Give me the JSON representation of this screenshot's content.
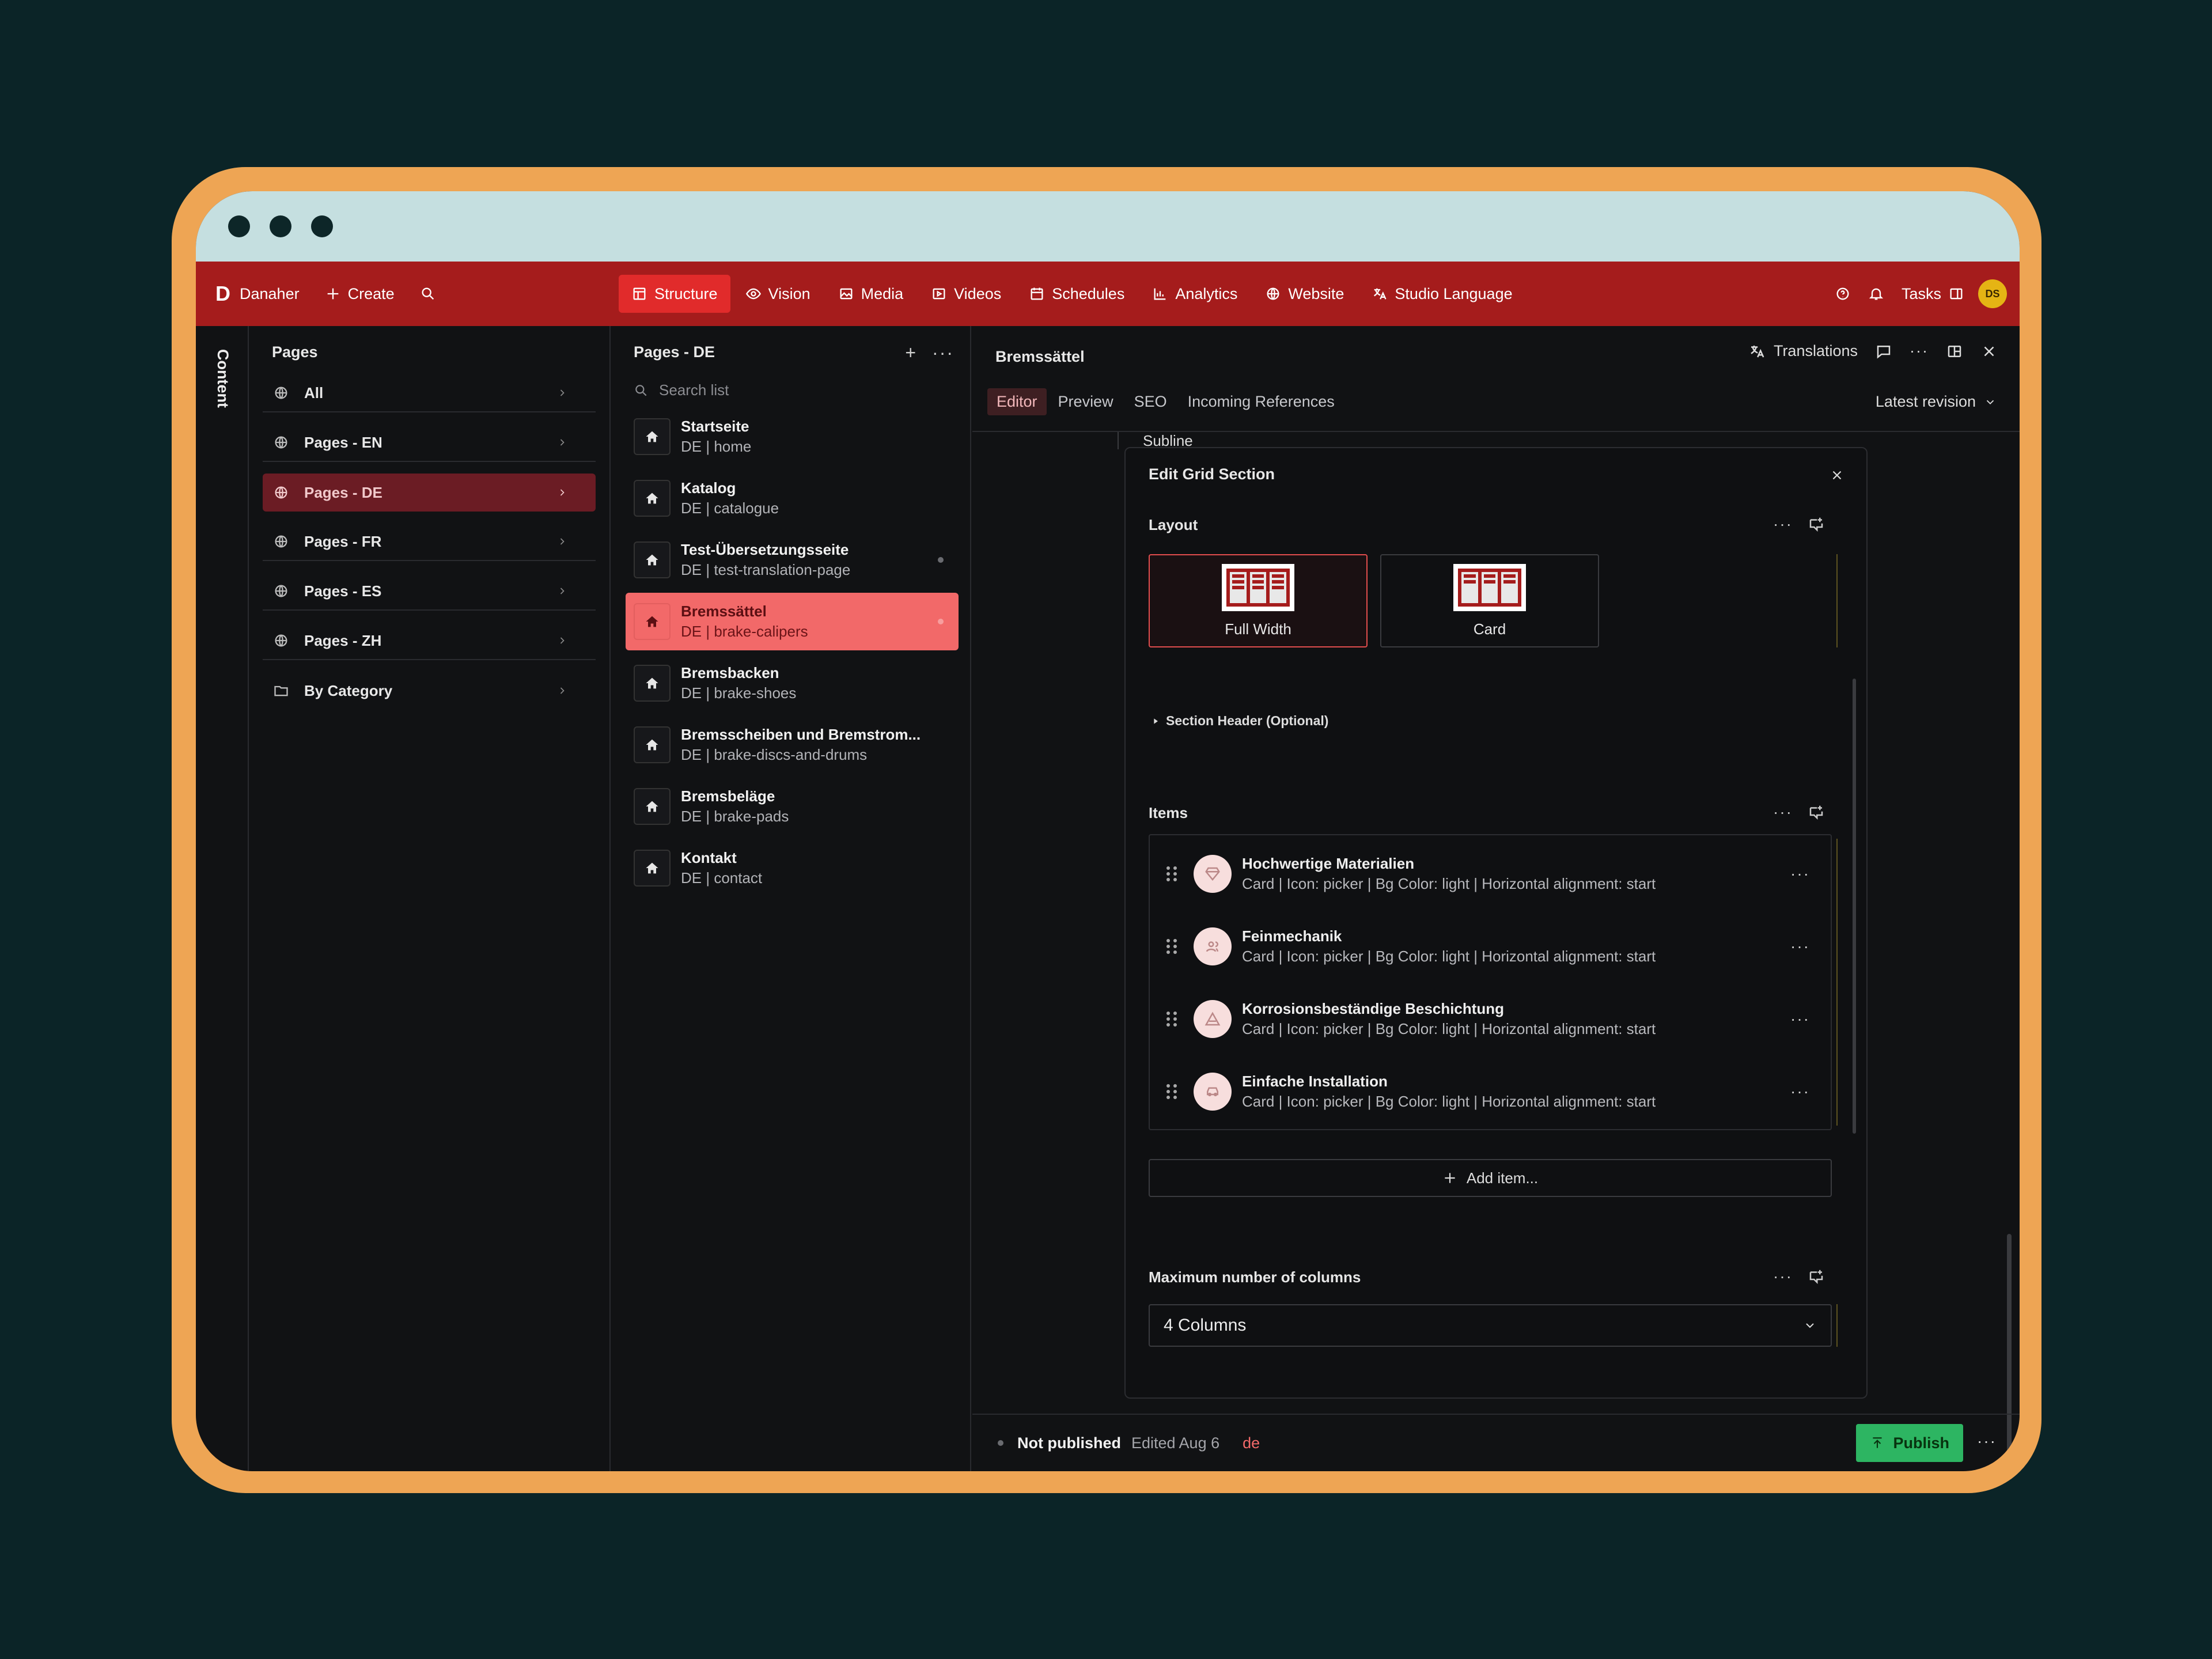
{
  "app": {
    "logo": "D",
    "workspace": "Danaher",
    "create_label": "Create",
    "tasks_label": "Tasks",
    "avatar_initials": "DS"
  },
  "nav": {
    "tools": [
      {
        "label": "Structure",
        "icon": "structure-icon",
        "active": true
      },
      {
        "label": "Vision",
        "icon": "eye-icon"
      },
      {
        "label": "Media",
        "icon": "image-icon"
      },
      {
        "label": "Videos",
        "icon": "video-icon"
      },
      {
        "label": "Schedules",
        "icon": "calendar-icon"
      },
      {
        "label": "Analytics",
        "icon": "chart-icon"
      },
      {
        "label": "Website",
        "icon": "globe-icon"
      },
      {
        "label": "Studio Language",
        "icon": "translate-icon"
      }
    ]
  },
  "rail": {
    "label": "Content"
  },
  "pages_panel": {
    "title": "Pages",
    "items": [
      {
        "label": "All",
        "icon": "globe-icon"
      },
      {
        "label": "Pages - EN",
        "icon": "globe-icon"
      },
      {
        "label": "Pages - DE",
        "icon": "globe-icon",
        "active": true
      },
      {
        "label": "Pages - FR",
        "icon": "globe-icon"
      },
      {
        "label": "Pages - ES",
        "icon": "globe-icon"
      },
      {
        "label": "Pages - ZH",
        "icon": "globe-icon"
      },
      {
        "label": "By Category",
        "icon": "folder-icon"
      }
    ]
  },
  "list_panel": {
    "title": "Pages - DE",
    "search_placeholder": "Search list",
    "items": [
      {
        "title": "Startseite",
        "sub": "DE | home"
      },
      {
        "title": "Katalog",
        "sub": "DE | catalogue"
      },
      {
        "title": "Test-Übersetzungsseite",
        "sub": "DE | test-translation-page",
        "dot": true
      },
      {
        "title": "Bremssättel",
        "sub": "DE | brake-calipers",
        "active": true,
        "dot": true
      },
      {
        "title": "Bremsbacken",
        "sub": "DE | brake-shoes"
      },
      {
        "title": "Bremsscheiben und Bremstrom...",
        "sub": "DE | brake-discs-and-drums"
      },
      {
        "title": "Bremsbeläge",
        "sub": "DE | brake-pads"
      },
      {
        "title": "Kontakt",
        "sub": "DE | contact"
      }
    ]
  },
  "document": {
    "title": "Bremssättel",
    "translations_label": "Translations",
    "tabs": [
      "Editor",
      "Preview",
      "SEO",
      "Incoming References"
    ],
    "active_tab": "Editor",
    "revision": "Latest revision",
    "subline_label": "Subline"
  },
  "modal": {
    "title": "Edit Grid Section",
    "layout_label": "Layout",
    "layout_options": [
      {
        "label": "Full Width",
        "selected": true
      },
      {
        "label": "Card"
      }
    ],
    "section_header_label": "Section Header (Optional)",
    "items_label": "Items",
    "items": [
      {
        "title": "Hochwertige Materialien",
        "sub": "Card | Icon: picker | Bg Color: light | Horizontal alignment: start",
        "icon": "diamond-icon"
      },
      {
        "title": "Feinmechanik",
        "sub": "Card | Icon: picker | Bg Color: light | Horizontal alignment: start",
        "icon": "users-icon"
      },
      {
        "title": "Korrosionsbeständige Beschichtung",
        "sub": "Card | Icon: picker | Bg Color: light | Horizontal alignment: start",
        "icon": "warning-icon"
      },
      {
        "title": "Einfache Installation",
        "sub": "Card | Icon: picker | Bg Color: light | Horizontal alignment: start",
        "icon": "car-icon"
      }
    ],
    "add_item_label": "Add item...",
    "columns_label": "Maximum number of columns",
    "columns_value": "4 Columns"
  },
  "footer": {
    "status": "Not published",
    "edited": "Edited Aug 6",
    "lang": "de",
    "publish_label": "Publish"
  },
  "colors": {
    "brand_red": "#a51c1c",
    "active_tool": "#e12b2b",
    "selected_page": "#f26969",
    "publish_green": "#2db562",
    "frame_orange": "#eea554"
  }
}
